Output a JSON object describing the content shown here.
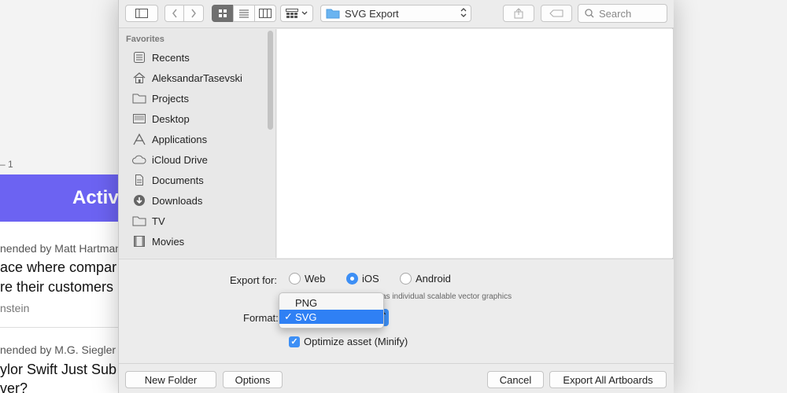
{
  "background_app": {
    "page_number": "– 1",
    "banner_text": "Activi",
    "entries": [
      {
        "meta": "nended by Matt Hartman",
        "title_lines": [
          "ace where compar",
          "re their customers"
        ],
        "author": "nstein"
      },
      {
        "meta": "nended by M.G. Siegler a",
        "title_lines": [
          "ylor Swift Just Sub",
          "ver?"
        ]
      }
    ],
    "banner_color": "#6c63f2"
  },
  "toolbar": {
    "path_label": "SVG Export",
    "search_placeholder": "Search"
  },
  "sidebar": {
    "heading": "Favorites",
    "items": [
      {
        "label": "Recents",
        "icon": "recents-icon"
      },
      {
        "label": "AleksandarTasevski",
        "icon": "home-icon"
      },
      {
        "label": "Projects",
        "icon": "folder-icon"
      },
      {
        "label": "Desktop",
        "icon": "desktop-icon"
      },
      {
        "label": "Applications",
        "icon": "applications-icon"
      },
      {
        "label": "iCloud Drive",
        "icon": "cloud-icon"
      },
      {
        "label": "Documents",
        "icon": "documents-icon"
      },
      {
        "label": "Downloads",
        "icon": "downloads-icon"
      },
      {
        "label": "TV",
        "icon": "folder-icon"
      },
      {
        "label": "Movies",
        "icon": "movies-icon"
      }
    ]
  },
  "options": {
    "export_for_label": "Export for:",
    "platforms": [
      {
        "label": "Web",
        "selected": false
      },
      {
        "label": "iOS",
        "selected": true
      },
      {
        "label": "Android",
        "selected": false
      }
    ],
    "hint": "as individual scalable vector graphics",
    "format_label": "Format:",
    "format_options": [
      {
        "label": "PNG",
        "selected": false
      },
      {
        "label": "SVG",
        "selected": true
      }
    ],
    "check_mark": "✓",
    "optimize_label": "Optimize asset (Minify)",
    "optimize_checked": true,
    "accent_color": "#3d8ff5"
  },
  "buttons": {
    "new_folder": "New Folder",
    "options": "Options",
    "cancel": "Cancel",
    "export": "Export All Artboards"
  }
}
